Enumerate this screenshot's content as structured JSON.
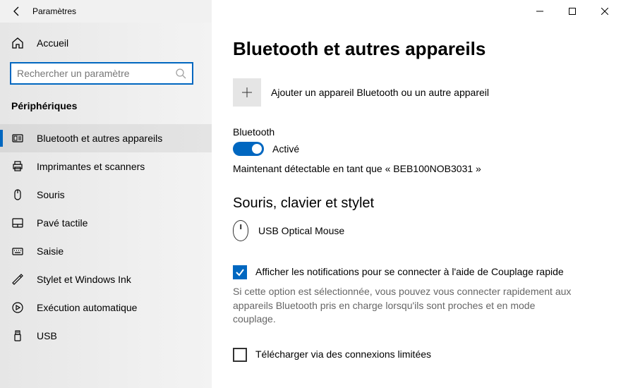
{
  "titlebar": {
    "title": "Paramètres"
  },
  "sidebar": {
    "home_label": "Accueil",
    "search_placeholder": "Rechercher un paramètre",
    "category": "Périphériques",
    "items": [
      {
        "label": "Bluetooth et autres appareils"
      },
      {
        "label": "Imprimantes et scanners"
      },
      {
        "label": "Souris"
      },
      {
        "label": "Pavé tactile"
      },
      {
        "label": "Saisie"
      },
      {
        "label": "Stylet et Windows Ink"
      },
      {
        "label": "Exécution automatique"
      },
      {
        "label": "USB"
      }
    ]
  },
  "main": {
    "page_title": "Bluetooth et autres appareils",
    "add_device_label": "Ajouter un appareil Bluetooth ou un autre appareil",
    "bt_label": "Bluetooth",
    "bt_state": "Activé",
    "discoverable_text": "Maintenant détectable en tant que « BEB100NOB3031 »",
    "mouse_section": "Souris, clavier et stylet",
    "mouse_device": "USB Optical Mouse",
    "swift_pair_label": "Afficher les notifications pour se connecter à l'aide de Couplage rapide",
    "swift_pair_help": "Si cette option est sélectionnée, vous pouvez vous connecter rapidement aux appareils Bluetooth pris en charge lorsqu'ils sont proches et en mode couplage.",
    "metered_label": "Télécharger via des connexions limitées"
  }
}
